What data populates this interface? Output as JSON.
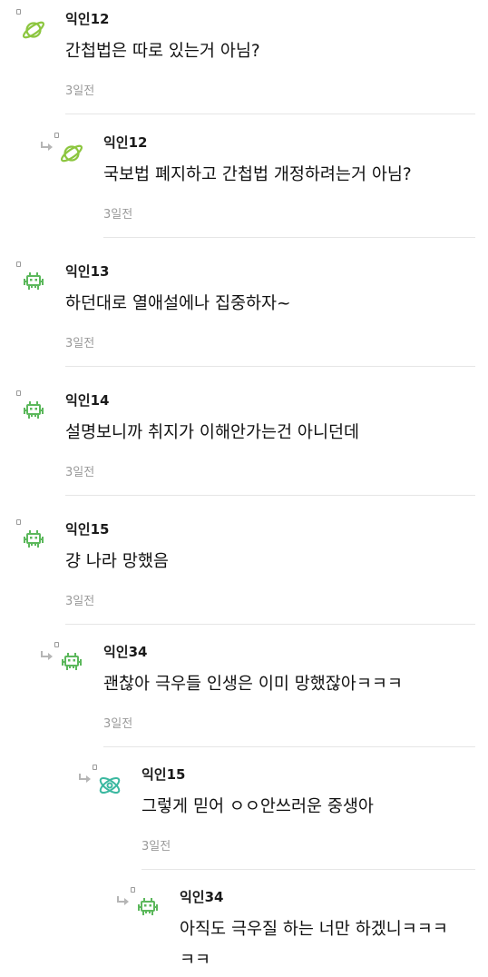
{
  "comments": [
    {
      "author": "익인12",
      "text": "간첩법은 따로 있는거 아님?",
      "time": "3일전",
      "avatar": "planet-icon",
      "depth": 0,
      "reply": false
    },
    {
      "author": "익인12",
      "text": "국보법 폐지하고 간첩법 개정하려는거 아님?",
      "time": "3일전",
      "avatar": "planet-icon",
      "depth": 1,
      "reply": true
    },
    {
      "author": "익인13",
      "text": "하던대로 열애설에나 집중하자~",
      "time": "3일전",
      "avatar": "space-invader-icon",
      "depth": 0,
      "reply": false
    },
    {
      "author": "익인14",
      "text": "설명보니까 취지가 이해안가는건 아니던데",
      "time": "3일전",
      "avatar": "space-invader-icon",
      "depth": 0,
      "reply": false
    },
    {
      "author": "익인15",
      "text": "걍 나라 망했음",
      "time": "3일전",
      "avatar": "space-invader-icon",
      "depth": 0,
      "reply": false
    },
    {
      "author": "익인34",
      "text": "괜찮아 극우들 인생은 이미 망했잖아ㅋㅋㅋ",
      "time": "3일전",
      "avatar": "space-invader-icon",
      "depth": 1,
      "reply": true
    },
    {
      "author": "익인15",
      "text": "그렇게 믿어 ㅇㅇ안쓰러운 중생아",
      "time": "3일전",
      "avatar": "atom-icon",
      "depth": 2,
      "reply": true
    },
    {
      "author": "익인34",
      "text": "아직도 극우질 하는 너만 하겠니ㅋㅋㅋ",
      "text2": "ㅋㅋ",
      "time": "",
      "avatar": "space-invader-icon",
      "depth": 3,
      "reply": true
    }
  ],
  "colors": {
    "planet": "#8cc63f",
    "invader": "#5cb85c",
    "atom": "#3bb8a0",
    "meta": "#9a9a9a",
    "divider": "#e6e6e6"
  }
}
